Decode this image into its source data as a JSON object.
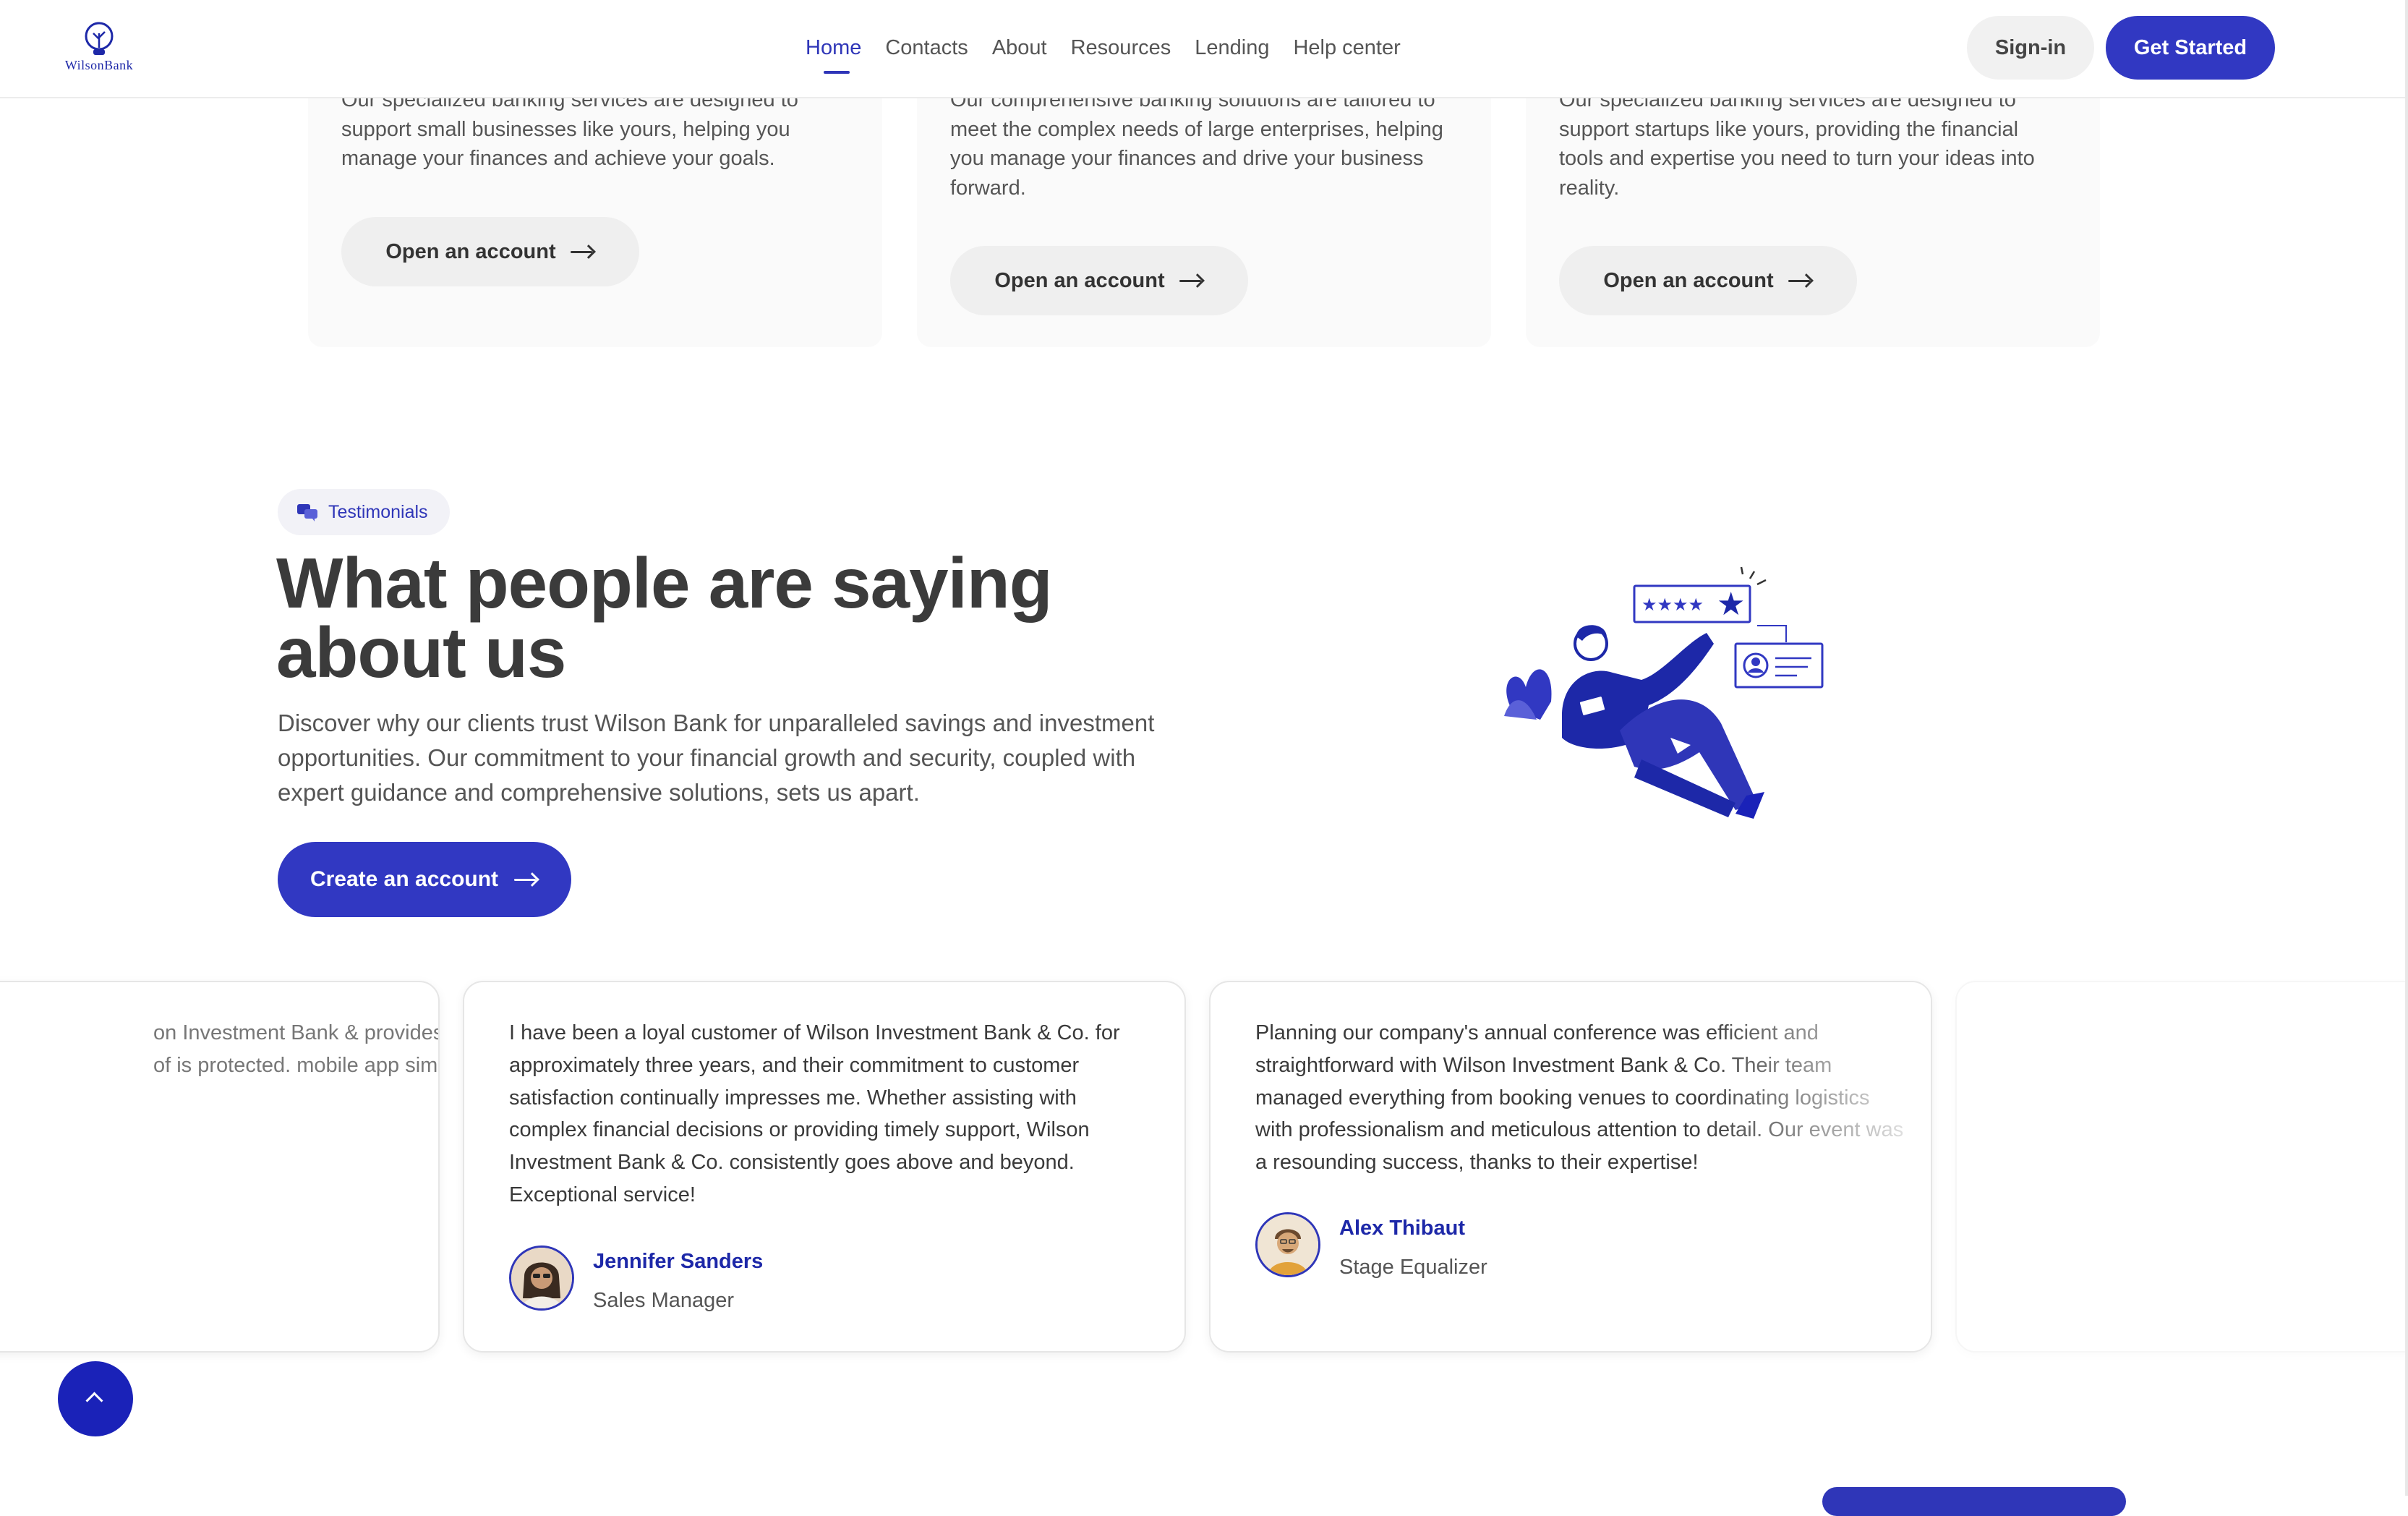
{
  "header": {
    "logo_text": "WilsonBank",
    "nav": [
      "Home",
      "Contacts",
      "About",
      "Resources",
      "Lending",
      "Help center"
    ],
    "active_nav": "Home",
    "signin_label": "Sign-in",
    "get_started_label": "Get Started"
  },
  "services": [
    {
      "description": "Our specialized banking services are designed to support small businesses like yours, helping you manage your finances and achieve your goals.",
      "button_label": "Open an account"
    },
    {
      "description": "Our comprehensive banking solutions are tailored to meet the complex needs of large enterprises, helping you manage your finances and drive your business forward.",
      "button_label": "Open an account"
    },
    {
      "description": "Our specialized banking services are designed to support startups like yours, providing the financial tools and expertise you need to turn your ideas into reality.",
      "button_label": "Open an account"
    }
  ],
  "testimonials_section": {
    "badge_label": "Testimonials",
    "heading_line1": "What people are saying",
    "heading_line2": "about us",
    "lead": "Discover why our clients trust Wilson Bank for unparalleled savings and investment opportunities. Our commitment to your financial growth and security, coupled with expert guidance and comprehensive solutions, sets us apart.",
    "cta_label": "Create an account"
  },
  "testimonials": [
    {
      "quote_fragment": "on Investment Bank & provides peace of is protected. mobile app simplify"
    },
    {
      "quote": "I have been a loyal customer of Wilson Investment Bank & Co. for approximately three years, and their commitment to customer satisfaction continually impresses me. Whether assisting with complex financial decisions or providing timely support, Wilson Investment Bank & Co. consistently goes above and beyond. Exceptional service!",
      "name": "Jennifer Sanders",
      "role": "Sales Manager"
    },
    {
      "quote": "Planning our company's annual conference was efficient and straightforward with Wilson Investment Bank & Co. Their team managed everything from booking venues to coordinating logistics with professionalism and meticulous attention to detail. Our event was a resounding success, thanks to their expertise!",
      "name": "Alex Thibaut",
      "role": "Stage Equalizer"
    }
  ],
  "colors": {
    "brand": "#3138c2",
    "brand_dark": "#1a22b8",
    "name_blue": "#1d28a8"
  }
}
